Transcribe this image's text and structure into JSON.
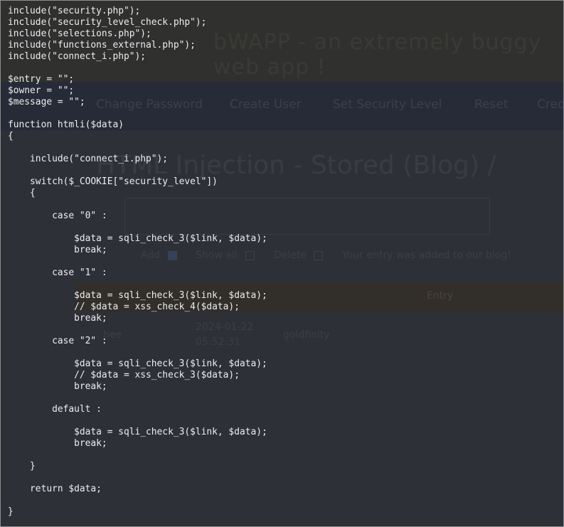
{
  "background": {
    "site_title": "bWAPP - an extremely buggy web app !",
    "menu": [
      "Change Password",
      "Create User",
      "Set Security Level",
      "Reset",
      "Credits"
    ],
    "heading": "HTML Injection - Stored (Blog) /",
    "controls": {
      "add_label": "Add",
      "show_all_label": "Show all",
      "delete_label": "Delete",
      "message": "Your entry was added to our blog!"
    },
    "table_header": "Entry",
    "row": {
      "entry": "bee",
      "date": "2024-01-22",
      "time": "05:52:31",
      "text": "goldfinity"
    }
  },
  "code": {
    "lines": [
      "include(\"security.php\");",
      "include(\"security_level_check.php\");",
      "include(\"selections.php\");",
      "include(\"functions_external.php\");",
      "include(\"connect_i.php\");",
      "",
      "$entry = \"\";",
      "$owner = \"\";",
      "$message = \"\";",
      "",
      "function htmli($data)",
      "{",
      "",
      "    include(\"connect_i.php\");",
      "",
      "    switch($_COOKIE[\"security_level\"])",
      "    {",
      "",
      "        case \"0\" :",
      "",
      "            $data = sqli_check_3($link, $data);",
      "            break;",
      "",
      "        case \"1\" :",
      "",
      "            $data = sqli_check_3($link, $data);",
      "            // $data = xss_check_4($data);",
      "            break;",
      "",
      "        case \"2\" :",
      "",
      "            $data = sqli_check_3($link, $data);",
      "            // $data = xss_check_3($data);",
      "            break;",
      "",
      "        default :",
      "",
      "            $data = sqli_check_3($link, $data);",
      "            break;",
      "",
      "    }",
      "",
      "    return $data;",
      "",
      "}"
    ]
  }
}
